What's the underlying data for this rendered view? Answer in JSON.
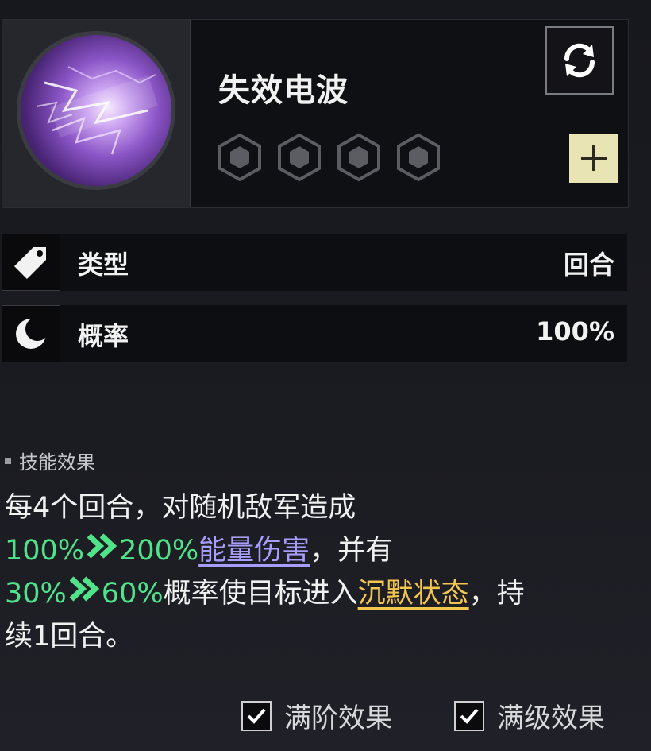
{
  "skill": {
    "name": "失效电波",
    "icon": "lightning-orb-icon",
    "pips_count": 4
  },
  "stats": [
    {
      "icon": "tag-icon",
      "label": "类型",
      "value": "回合"
    },
    {
      "icon": "crescent-moon-icon",
      "label": "概率",
      "value": "100%"
    }
  ],
  "effect": {
    "header": "技能效果",
    "line1": "每4个回合，对随机敌军造成",
    "dmg_from": "100%",
    "dmg_to": "200%",
    "dmg_keyword": "能量伤害",
    "line2_tail": "，并有",
    "prob_from": "30%",
    "prob_to": "60%",
    "line3_mid": "概率使目标进入",
    "status_keyword": "沉默状态",
    "line3_tail": "，持",
    "line4": "续1回合。"
  },
  "toggles": [
    {
      "label": "满阶效果",
      "checked": true
    },
    {
      "label": "满级效果",
      "checked": true
    }
  ],
  "colors": {
    "value_highlight": "#4fe38a",
    "damage_keyword": "#a79cff",
    "status_keyword": "#f3c64e",
    "add_button": "#e9e4b4"
  }
}
